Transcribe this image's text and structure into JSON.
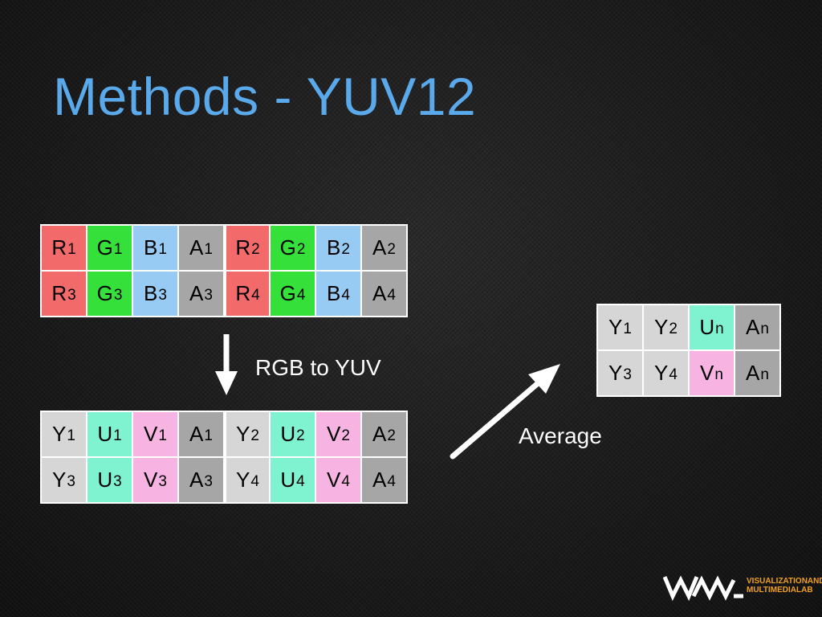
{
  "title": "Methods - YUV12",
  "colors": {
    "title": "#5aa9ea",
    "R": "#f36a6a",
    "G": "#35e03b",
    "B": "#98cbf3",
    "A": "#a6a6a6",
    "Y": "#d6d6d6",
    "U": "#7ff2cf",
    "V": "#f7b3e1",
    "logo": "#f0a020"
  },
  "rgba_grid": [
    [
      {
        "ch": "R",
        "sub": "1"
      },
      {
        "ch": "G",
        "sub": "1"
      },
      {
        "ch": "B",
        "sub": "1"
      },
      {
        "ch": "A",
        "sub": "1"
      },
      {
        "ch": "R",
        "sub": "2"
      },
      {
        "ch": "G",
        "sub": "2"
      },
      {
        "ch": "B",
        "sub": "2"
      },
      {
        "ch": "A",
        "sub": "2"
      }
    ],
    [
      {
        "ch": "R",
        "sub": "3"
      },
      {
        "ch": "G",
        "sub": "3"
      },
      {
        "ch": "B",
        "sub": "3"
      },
      {
        "ch": "A",
        "sub": "3"
      },
      {
        "ch": "R",
        "sub": "4"
      },
      {
        "ch": "G",
        "sub": "4"
      },
      {
        "ch": "B",
        "sub": "4"
      },
      {
        "ch": "A",
        "sub": "4"
      }
    ]
  ],
  "yuva_grid": [
    [
      {
        "ch": "Y",
        "sub": "1"
      },
      {
        "ch": "U",
        "sub": "1"
      },
      {
        "ch": "V",
        "sub": "1"
      },
      {
        "ch": "A",
        "sub": "1"
      },
      {
        "ch": "Y",
        "sub": "2"
      },
      {
        "ch": "U",
        "sub": "2"
      },
      {
        "ch": "V",
        "sub": "2"
      },
      {
        "ch": "A",
        "sub": "2"
      }
    ],
    [
      {
        "ch": "Y",
        "sub": "3"
      },
      {
        "ch": "U",
        "sub": "3"
      },
      {
        "ch": "V",
        "sub": "3"
      },
      {
        "ch": "A",
        "sub": "3"
      },
      {
        "ch": "Y",
        "sub": "4"
      },
      {
        "ch": "U",
        "sub": "4"
      },
      {
        "ch": "V",
        "sub": "4"
      },
      {
        "ch": "A",
        "sub": "4"
      }
    ]
  ],
  "yuv12_grid": [
    [
      {
        "ch": "Y",
        "sub": "1"
      },
      {
        "ch": "Y",
        "sub": "2"
      },
      {
        "ch": "U",
        "sub": "n"
      },
      {
        "ch": "A",
        "sub": "n"
      }
    ],
    [
      {
        "ch": "Y",
        "sub": "3"
      },
      {
        "ch": "Y",
        "sub": "4"
      },
      {
        "ch": "V",
        "sub": "n"
      },
      {
        "ch": "A",
        "sub": "n"
      }
    ]
  ],
  "labels": {
    "rgb_to_yuv": "RGB to YUV",
    "average": "Average"
  },
  "logo": {
    "line1": "VISUALIZATIONAND",
    "line2": "MULTIMEDIALAB",
    "icon": "wml-logo-icon"
  }
}
